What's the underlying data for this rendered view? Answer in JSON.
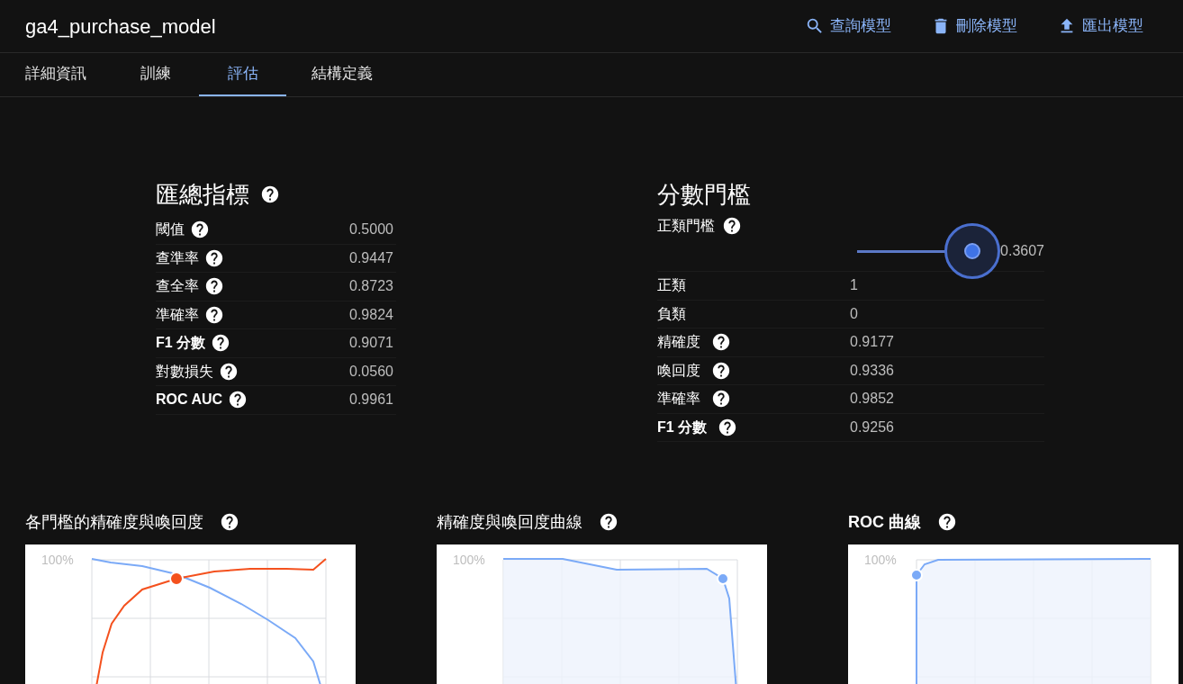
{
  "header": {
    "title": "ga4_purchase_model",
    "actions": [
      {
        "kind": "search",
        "label": "查詢模型"
      },
      {
        "kind": "delete",
        "label": "刪除模型"
      },
      {
        "kind": "export",
        "label": "匯出模型"
      }
    ]
  },
  "tabs": [
    {
      "label": "詳細資訊",
      "selected": false
    },
    {
      "label": "訓練",
      "selected": false
    },
    {
      "label": "評估",
      "selected": true
    },
    {
      "label": "結構定義",
      "selected": false
    }
  ],
  "aggregate_metrics": {
    "title": "匯總指標",
    "rows": [
      {
        "label": "閾值",
        "bold": false,
        "value": "0.5000"
      },
      {
        "label": "查準率",
        "bold": false,
        "value": "0.9447"
      },
      {
        "label": "查全率",
        "bold": false,
        "value": "0.8723"
      },
      {
        "label": "準確率",
        "bold": false,
        "value": "0.9824"
      },
      {
        "label": "F1 分數",
        "bold": true,
        "value": "0.9071"
      },
      {
        "label": "對數損失",
        "bold": false,
        "value": "0.0560"
      },
      {
        "label": "ROC AUC",
        "bold": true,
        "value": "0.9961"
      }
    ]
  },
  "score_threshold": {
    "title": "分數門檻",
    "slider": {
      "label": "正類門檻",
      "level": 0.88,
      "reading": "0.3607"
    },
    "rows": [
      {
        "label": "正類",
        "help": false,
        "bold": false,
        "value": "1"
      },
      {
        "label": "負類",
        "help": false,
        "bold": false,
        "value": "0"
      },
      {
        "label": "精確度",
        "help": true,
        "bold": false,
        "value": "0.9177"
      },
      {
        "label": "喚回度",
        "help": true,
        "bold": false,
        "value": "0.9336"
      },
      {
        "label": "準確率",
        "help": true,
        "bold": false,
        "value": "0.9852"
      },
      {
        "label": "F1 分數",
        "help": true,
        "bold": true,
        "value": "0.9256"
      }
    ]
  },
  "charts": [
    {
      "kind": "threshold",
      "title": "各門檻的精確度與喚回度",
      "bold": false,
      "y_label": "100%"
    },
    {
      "kind": "pr",
      "title": "精確度與喚回度曲線",
      "bold": false,
      "y_label": "100%"
    },
    {
      "kind": "roc",
      "title": "ROC 曲線",
      "bold": true,
      "y_label": "100%"
    }
  ]
}
